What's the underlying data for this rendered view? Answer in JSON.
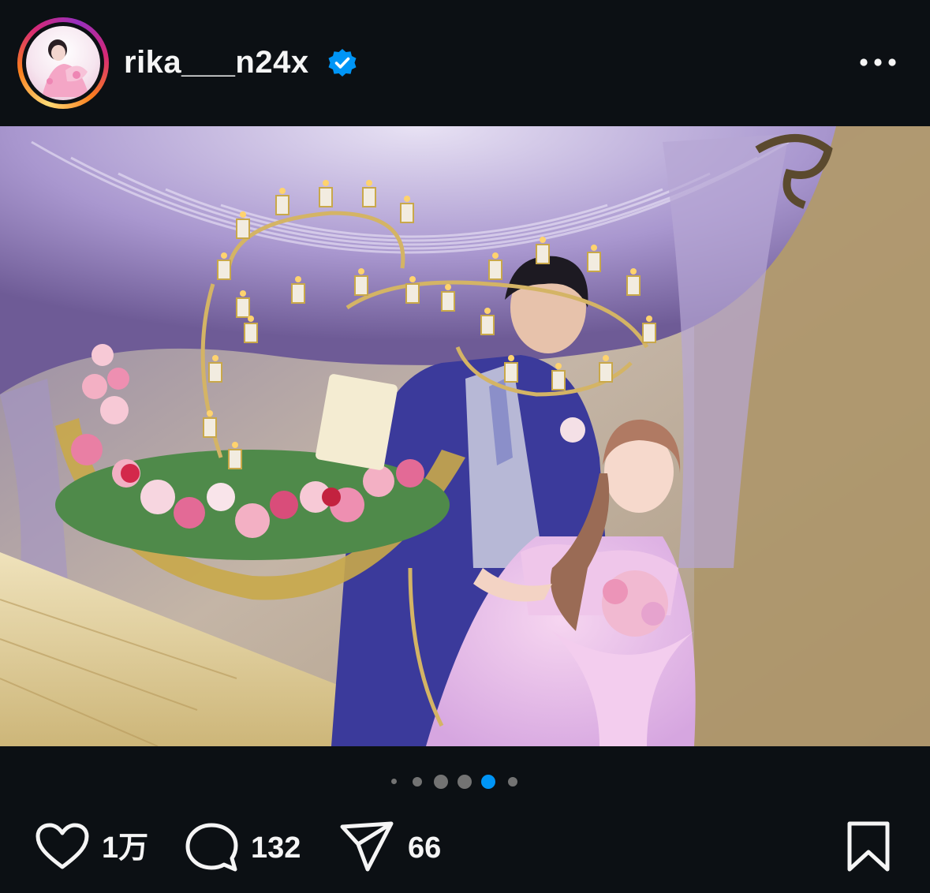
{
  "post": {
    "username": "rika___n24x",
    "verified": true,
    "photo_description": "Wedding photo: couple lighting a candelabra with pink roses",
    "carousel": {
      "total": 6,
      "current": 4
    },
    "stats": {
      "likes": "1万",
      "comments": "132",
      "shares": "66"
    }
  },
  "icons": {
    "verified": "verified-badge-icon",
    "more": "more-options-icon",
    "like": "heart-icon",
    "comment": "comment-bubble-icon",
    "share": "paper-plane-icon",
    "save": "bookmark-icon"
  },
  "colors": {
    "background": "#0c1014",
    "text": "#f5f5f5",
    "verified": "#0095f6",
    "dot_active": "#0095f6",
    "dot_inactive": "#737373"
  }
}
